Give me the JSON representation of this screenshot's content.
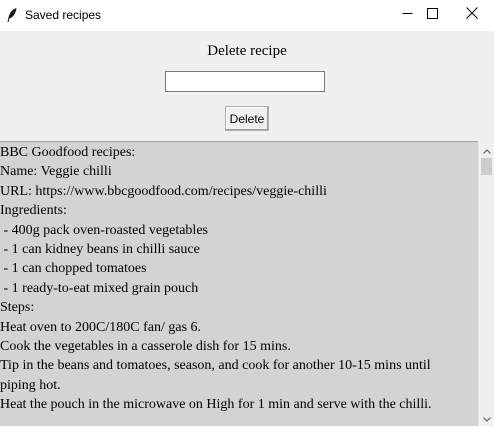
{
  "window": {
    "title": "Saved recipes",
    "icon": "feather-icon",
    "controls": {
      "minimize": "minimize-icon",
      "maximize": "maximize-icon",
      "close": "close-icon"
    }
  },
  "delete_form": {
    "heading": "Delete recipe",
    "input_value": "",
    "button_label": "Delete"
  },
  "recipes_text": {
    "lines": [
      "BBC Goodfood recipes:",
      "Name: Veggie chilli",
      "URL: https://www.bbcgoodfood.com/recipes/veggie-chilli",
      "Ingredients:",
      " - 400g pack oven-roasted vegetables",
      " - 1 can kidney beans in chilli sauce",
      " - 1 can chopped tomatoes",
      " - 1 ready-to-eat mixed grain pouch",
      "Steps:",
      "Heat oven to 200C/180C fan/ gas 6.",
      "Cook the vegetables in a casserole dish for 15 mins.",
      "Tip in the beans and tomatoes, season, and cook for another 10-15 mins until",
      "piping hot.",
      "Heat the pouch in the microwave on High for 1 min and serve with the chilli."
    ]
  },
  "colors": {
    "window_bg": "#f0f0f0",
    "text_area_bg": "#d3d3d3"
  }
}
